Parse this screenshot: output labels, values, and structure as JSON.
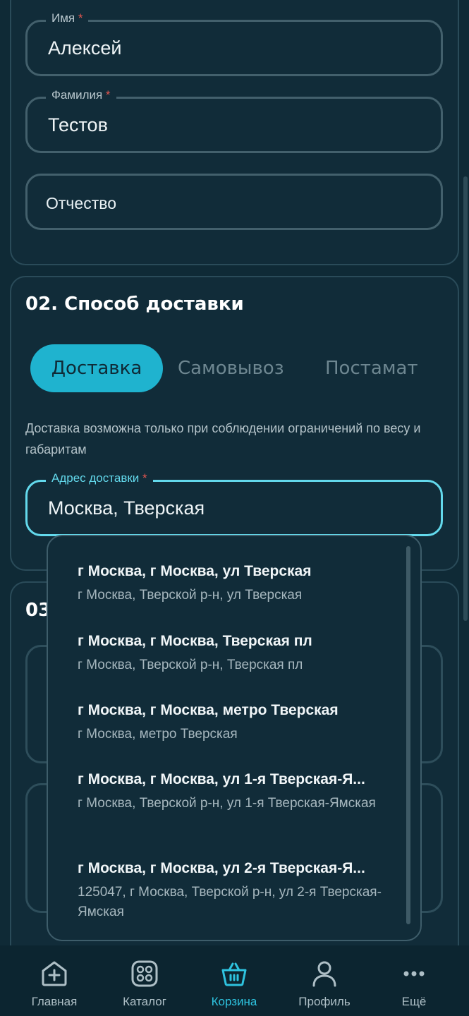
{
  "name_section": {
    "first_name": {
      "label": "Имя",
      "required": "*",
      "value": "Алексей"
    },
    "last_name": {
      "label": "Фамилия",
      "required": "*",
      "value": "Тестов"
    },
    "middle_name": {
      "placeholder": "Отчество"
    }
  },
  "delivery_section": {
    "title": "02. Способ доставки",
    "tabs": [
      {
        "label": "Доставка",
        "active": true
      },
      {
        "label": "Самовывоз",
        "active": false
      },
      {
        "label": "Постамат",
        "active": false
      }
    ],
    "hint": "Доставка возможна только при соблюдении ограничений по весу и габаритам",
    "address": {
      "label": "Адрес доставки",
      "required": "*",
      "value": "Москва, Тверская"
    }
  },
  "third_section": {
    "title_partial": "03"
  },
  "suggestions": [
    {
      "main": "г Москва, г Москва, ул Тверская",
      "sub": "г Москва, Тверской р-н, ул Тверская"
    },
    {
      "main": "г Москва, г Москва, Тверская пл",
      "sub": "г Москва, Тверской р-н, Тверская пл"
    },
    {
      "main": "г Москва, г Москва, метро Тверская",
      "sub": "г Москва, метро Тверская"
    },
    {
      "main": "г Москва, г Москва, ул 1-я Тверская-Я...",
      "sub": "г Москва, Тверской р-н, ул 1-я Тверская-Ямская"
    },
    {
      "main": "г Москва, г Москва, ул 2-я Тверская-Я...",
      "sub": "125047, г Москва, Тверской р-н, ул 2-я Тверская-Ямская"
    }
  ],
  "bottom_nav": [
    {
      "label": "Главная",
      "icon": "home-plus-icon",
      "active": false
    },
    {
      "label": "Каталог",
      "icon": "catalog-grid-icon",
      "active": false
    },
    {
      "label": "Корзина",
      "icon": "basket-icon",
      "active": true
    },
    {
      "label": "Профиль",
      "icon": "profile-icon",
      "active": false
    },
    {
      "label": "Ещё",
      "icon": "more-dots-icon",
      "active": false
    }
  ],
  "colors": {
    "background": "#0f2a36",
    "accent": "#1fb3cf",
    "focus": "#63d9ec",
    "required": "#e2554f"
  }
}
